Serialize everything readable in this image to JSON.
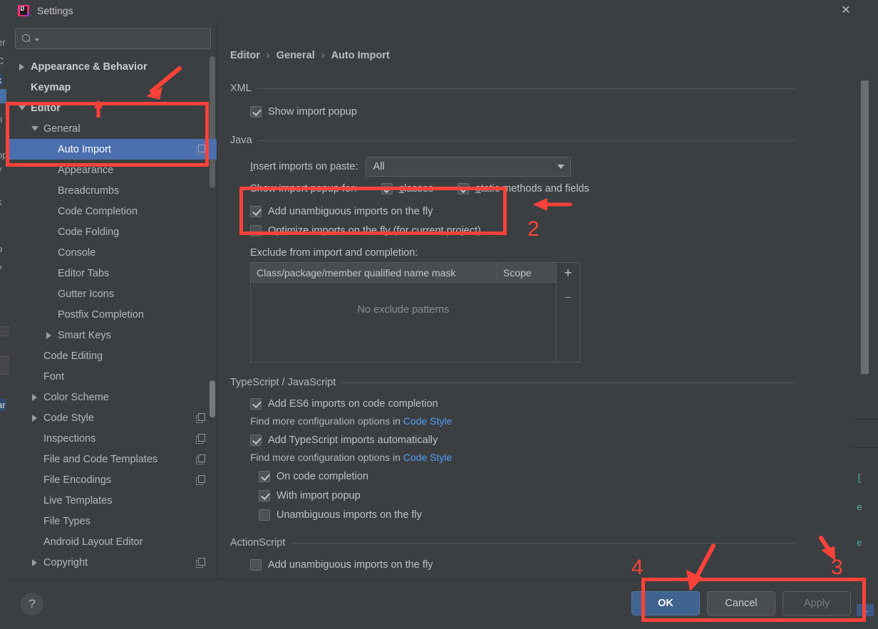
{
  "window": {
    "title": "Settings",
    "app_icon": "intellij-logo-icon",
    "close_label": "✕"
  },
  "sidebar": {
    "search": {
      "placeholder": "",
      "value": "",
      "icon": "search-icon"
    },
    "items": [
      {
        "label": "Appearance & Behavior",
        "indent": 0,
        "toggle": "collapsed",
        "bold": true,
        "selected": false,
        "badge": false
      },
      {
        "label": "Keymap",
        "indent": 0,
        "toggle": "none",
        "bold": true,
        "selected": false,
        "badge": false
      },
      {
        "label": "Editor",
        "indent": 0,
        "toggle": "expanded",
        "bold": true,
        "selected": false,
        "badge": false
      },
      {
        "label": "General",
        "indent": 1,
        "toggle": "expanded",
        "bold": false,
        "selected": false,
        "badge": false
      },
      {
        "label": "Auto Import",
        "indent": 2,
        "toggle": "none",
        "bold": false,
        "selected": true,
        "badge": true
      },
      {
        "label": "Appearance",
        "indent": 2,
        "toggle": "none",
        "bold": false,
        "selected": false,
        "badge": false
      },
      {
        "label": "Breadcrumbs",
        "indent": 2,
        "toggle": "none",
        "bold": false,
        "selected": false,
        "badge": false
      },
      {
        "label": "Code Completion",
        "indent": 2,
        "toggle": "none",
        "bold": false,
        "selected": false,
        "badge": false
      },
      {
        "label": "Code Folding",
        "indent": 2,
        "toggle": "none",
        "bold": false,
        "selected": false,
        "badge": false
      },
      {
        "label": "Console",
        "indent": 2,
        "toggle": "none",
        "bold": false,
        "selected": false,
        "badge": false
      },
      {
        "label": "Editor Tabs",
        "indent": 2,
        "toggle": "none",
        "bold": false,
        "selected": false,
        "badge": false
      },
      {
        "label": "Gutter Icons",
        "indent": 2,
        "toggle": "none",
        "bold": false,
        "selected": false,
        "badge": false
      },
      {
        "label": "Postfix Completion",
        "indent": 2,
        "toggle": "none",
        "bold": false,
        "selected": false,
        "badge": false
      },
      {
        "label": "Smart Keys",
        "indent": 2,
        "toggle": "collapsed",
        "bold": false,
        "selected": false,
        "badge": false
      },
      {
        "label": "Code Editing",
        "indent": 1,
        "toggle": "none",
        "bold": false,
        "selected": false,
        "badge": false
      },
      {
        "label": "Font",
        "indent": 1,
        "toggle": "none",
        "bold": false,
        "selected": false,
        "badge": false
      },
      {
        "label": "Color Scheme",
        "indent": 1,
        "toggle": "collapsed",
        "bold": false,
        "selected": false,
        "badge": false
      },
      {
        "label": "Code Style",
        "indent": 1,
        "toggle": "collapsed",
        "bold": false,
        "selected": false,
        "badge": true
      },
      {
        "label": "Inspections",
        "indent": 1,
        "toggle": "none",
        "bold": false,
        "selected": false,
        "badge": true
      },
      {
        "label": "File and Code Templates",
        "indent": 1,
        "toggle": "none",
        "bold": false,
        "selected": false,
        "badge": true
      },
      {
        "label": "File Encodings",
        "indent": 1,
        "toggle": "none",
        "bold": false,
        "selected": false,
        "badge": true
      },
      {
        "label": "Live Templates",
        "indent": 1,
        "toggle": "none",
        "bold": false,
        "selected": false,
        "badge": false
      },
      {
        "label": "File Types",
        "indent": 1,
        "toggle": "none",
        "bold": false,
        "selected": false,
        "badge": false
      },
      {
        "label": "Android Layout Editor",
        "indent": 1,
        "toggle": "none",
        "bold": false,
        "selected": false,
        "badge": false
      },
      {
        "label": "Copyright",
        "indent": 1,
        "toggle": "collapsed",
        "bold": false,
        "selected": false,
        "badge": true
      }
    ]
  },
  "main": {
    "breadcrumb": {
      "crumb1": "Editor",
      "crumb2": "General",
      "crumb3": "Auto Import",
      "separator": "›"
    },
    "xml": {
      "title": "XML",
      "show_import_popup": {
        "label": "Show import popup",
        "checked": true
      }
    },
    "java": {
      "title": "Java",
      "insert_imports_label": "Insert imports on paste:",
      "insert_imports_mnemonic": "I",
      "insert_imports_value": "All",
      "show_import_popup_for_label": "Show import popup for:",
      "classes": {
        "label": "classes",
        "mnemonic": "c",
        "checked": true
      },
      "static_methods": {
        "label": "static methods and fields",
        "mnemonic": "s",
        "checked": true
      },
      "add_unambiguous": {
        "label": "Add unambiguous imports on the fly",
        "checked": true
      },
      "optimize_imports": {
        "label": "Optimize imports on the fly (for current project)",
        "checked": false
      },
      "exclude_label": "Exclude from import and completion:",
      "table": {
        "columns": [
          "Class/package/member qualified name mask",
          "Scope"
        ],
        "rows": [],
        "empty_text": "No exclude patterns",
        "add_button": "+",
        "remove_button": "−"
      }
    },
    "typescript": {
      "title": "TypeScript / JavaScript",
      "add_es6": {
        "label": "Add ES6 imports on code completion",
        "checked": true
      },
      "hint1_prefix": "Find more configuration options in ",
      "hint1_link": "Code Style",
      "add_ts": {
        "label": "Add TypeScript imports automatically",
        "checked": true
      },
      "hint2_prefix": "Find more configuration options in ",
      "hint2_link": "Code Style",
      "on_code_completion": {
        "label": "On code completion",
        "checked": true
      },
      "with_import_popup": {
        "label": "With import popup",
        "checked": true
      },
      "unambiguous_on_the_fly": {
        "label": "Unambiguous imports on the fly",
        "checked": false
      }
    },
    "actionscript": {
      "title": "ActionScript",
      "add_unambiguous": {
        "label": "Add unambiguous imports on the fly",
        "checked": false
      }
    }
  },
  "footer": {
    "help_label": "?",
    "ok_label": "OK",
    "cancel_label": "Cancel",
    "apply_label": "Apply"
  },
  "annotations": {
    "color": "#f9423a",
    "num2": "2",
    "num3": "3",
    "num4": "4"
  },
  "background_ide": {
    "left_fragments": [
      "er",
      "C",
      "k",
      "n",
      "op",
      "y",
      "k",
      "p",
      "y",
      "k",
      "ar"
    ],
    "right_fragments": [
      "[",
      "e",
      "e",
      "1"
    ]
  }
}
